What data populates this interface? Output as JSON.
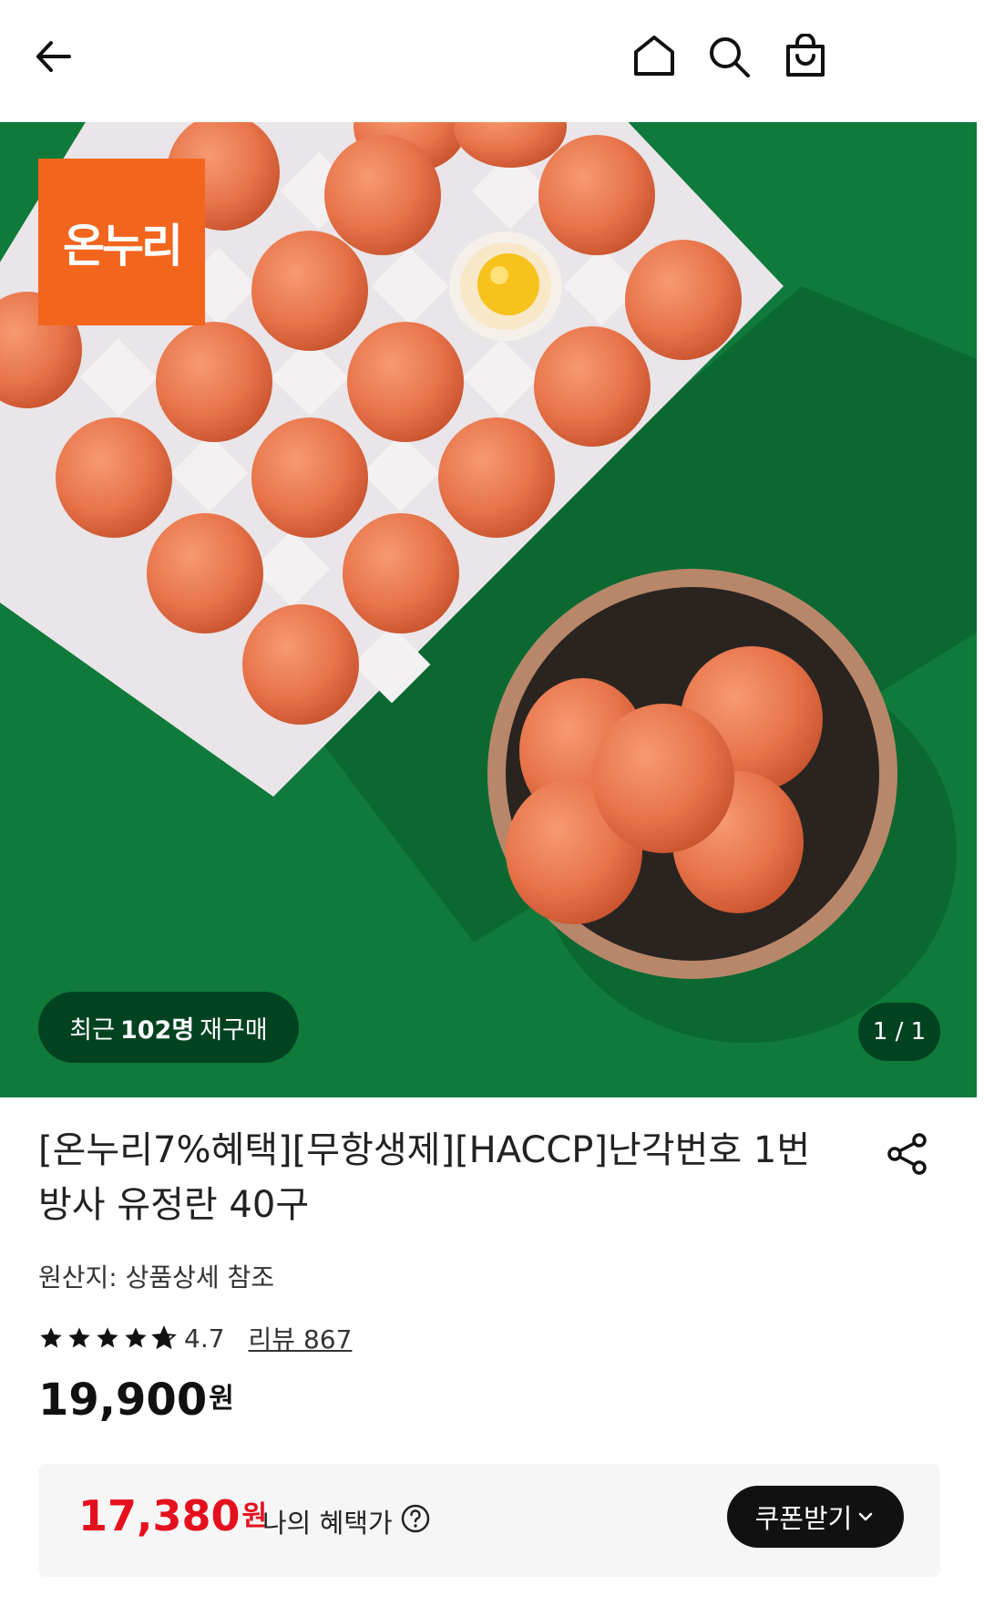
{
  "header": {
    "back_icon": "arrow-left-icon",
    "home_icon": "home-icon",
    "search_icon": "search-icon",
    "cart_icon": "shopping-bag-icon"
  },
  "gallery": {
    "badge_text": "온누리",
    "repurchase_prefix": "최근",
    "repurchase_count": "102명",
    "repurchase_suffix": "재구매",
    "counter": "1 / 1"
  },
  "product": {
    "title": "[온누리7%혜택][무항생제][HACCP]난각번호 1번 방사 유정란 40구",
    "origin": "원산지: 상품상세 참조",
    "rating": "4.7",
    "rating_fraction": 0.94,
    "review_link": "리뷰 867",
    "price": "19,900",
    "price_unit": "원"
  },
  "benefit": {
    "price": "17,380",
    "price_unit": "원",
    "label": "나의 혜택가",
    "coupon_button": "쿠폰받기"
  },
  "colors": {
    "badge": "#f2651d",
    "background_green": "#0f7a3a",
    "benefit_price": "#e5101d",
    "coupon_button_bg": "#111111"
  }
}
